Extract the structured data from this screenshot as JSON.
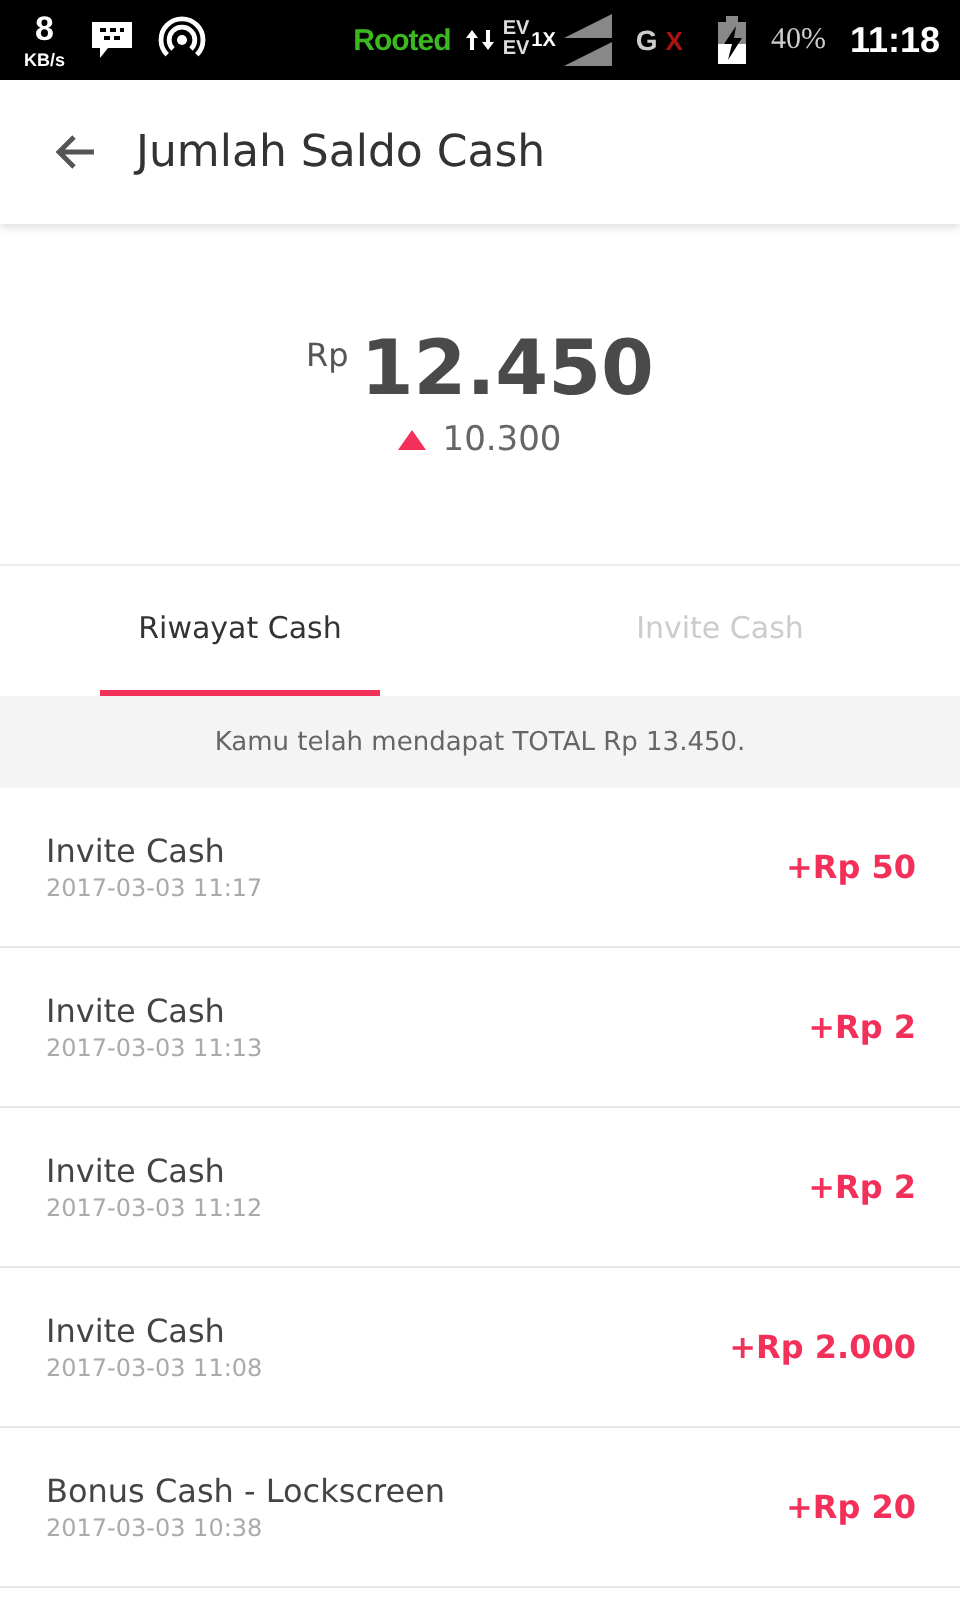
{
  "status_bar": {
    "speed": "8",
    "speed_unit": "KB/s",
    "rooted": "Rooted",
    "net_top": "EV",
    "net_bottom": "EV",
    "net_type": "1X",
    "g": "G",
    "g_x": "X",
    "battery": "40%",
    "time": "11:18"
  },
  "app_bar": {
    "title": "Jumlah Saldo Cash"
  },
  "balance": {
    "currency": "Rp",
    "amount": "12.450",
    "change": "10.300"
  },
  "tabs": [
    {
      "label": "Riwayat Cash",
      "selected": true
    },
    {
      "label": "Invite Cash",
      "selected": false
    }
  ],
  "summary": "Kamu telah mendapat TOTAL Rp 13.450.",
  "transactions": [
    {
      "title": "Invite Cash",
      "date": "2017-03-03 11:17",
      "amount": "+Rp 50"
    },
    {
      "title": "Invite Cash",
      "date": "2017-03-03 11:13",
      "amount": "+Rp 2"
    },
    {
      "title": "Invite Cash",
      "date": "2017-03-03 11:12",
      "amount": "+Rp 2"
    },
    {
      "title": "Invite Cash",
      "date": "2017-03-03 11:08",
      "amount": "+Rp 2.000"
    },
    {
      "title": "Bonus Cash - Lockscreen",
      "date": "2017-03-03 10:38",
      "amount": "+Rp 20"
    }
  ]
}
